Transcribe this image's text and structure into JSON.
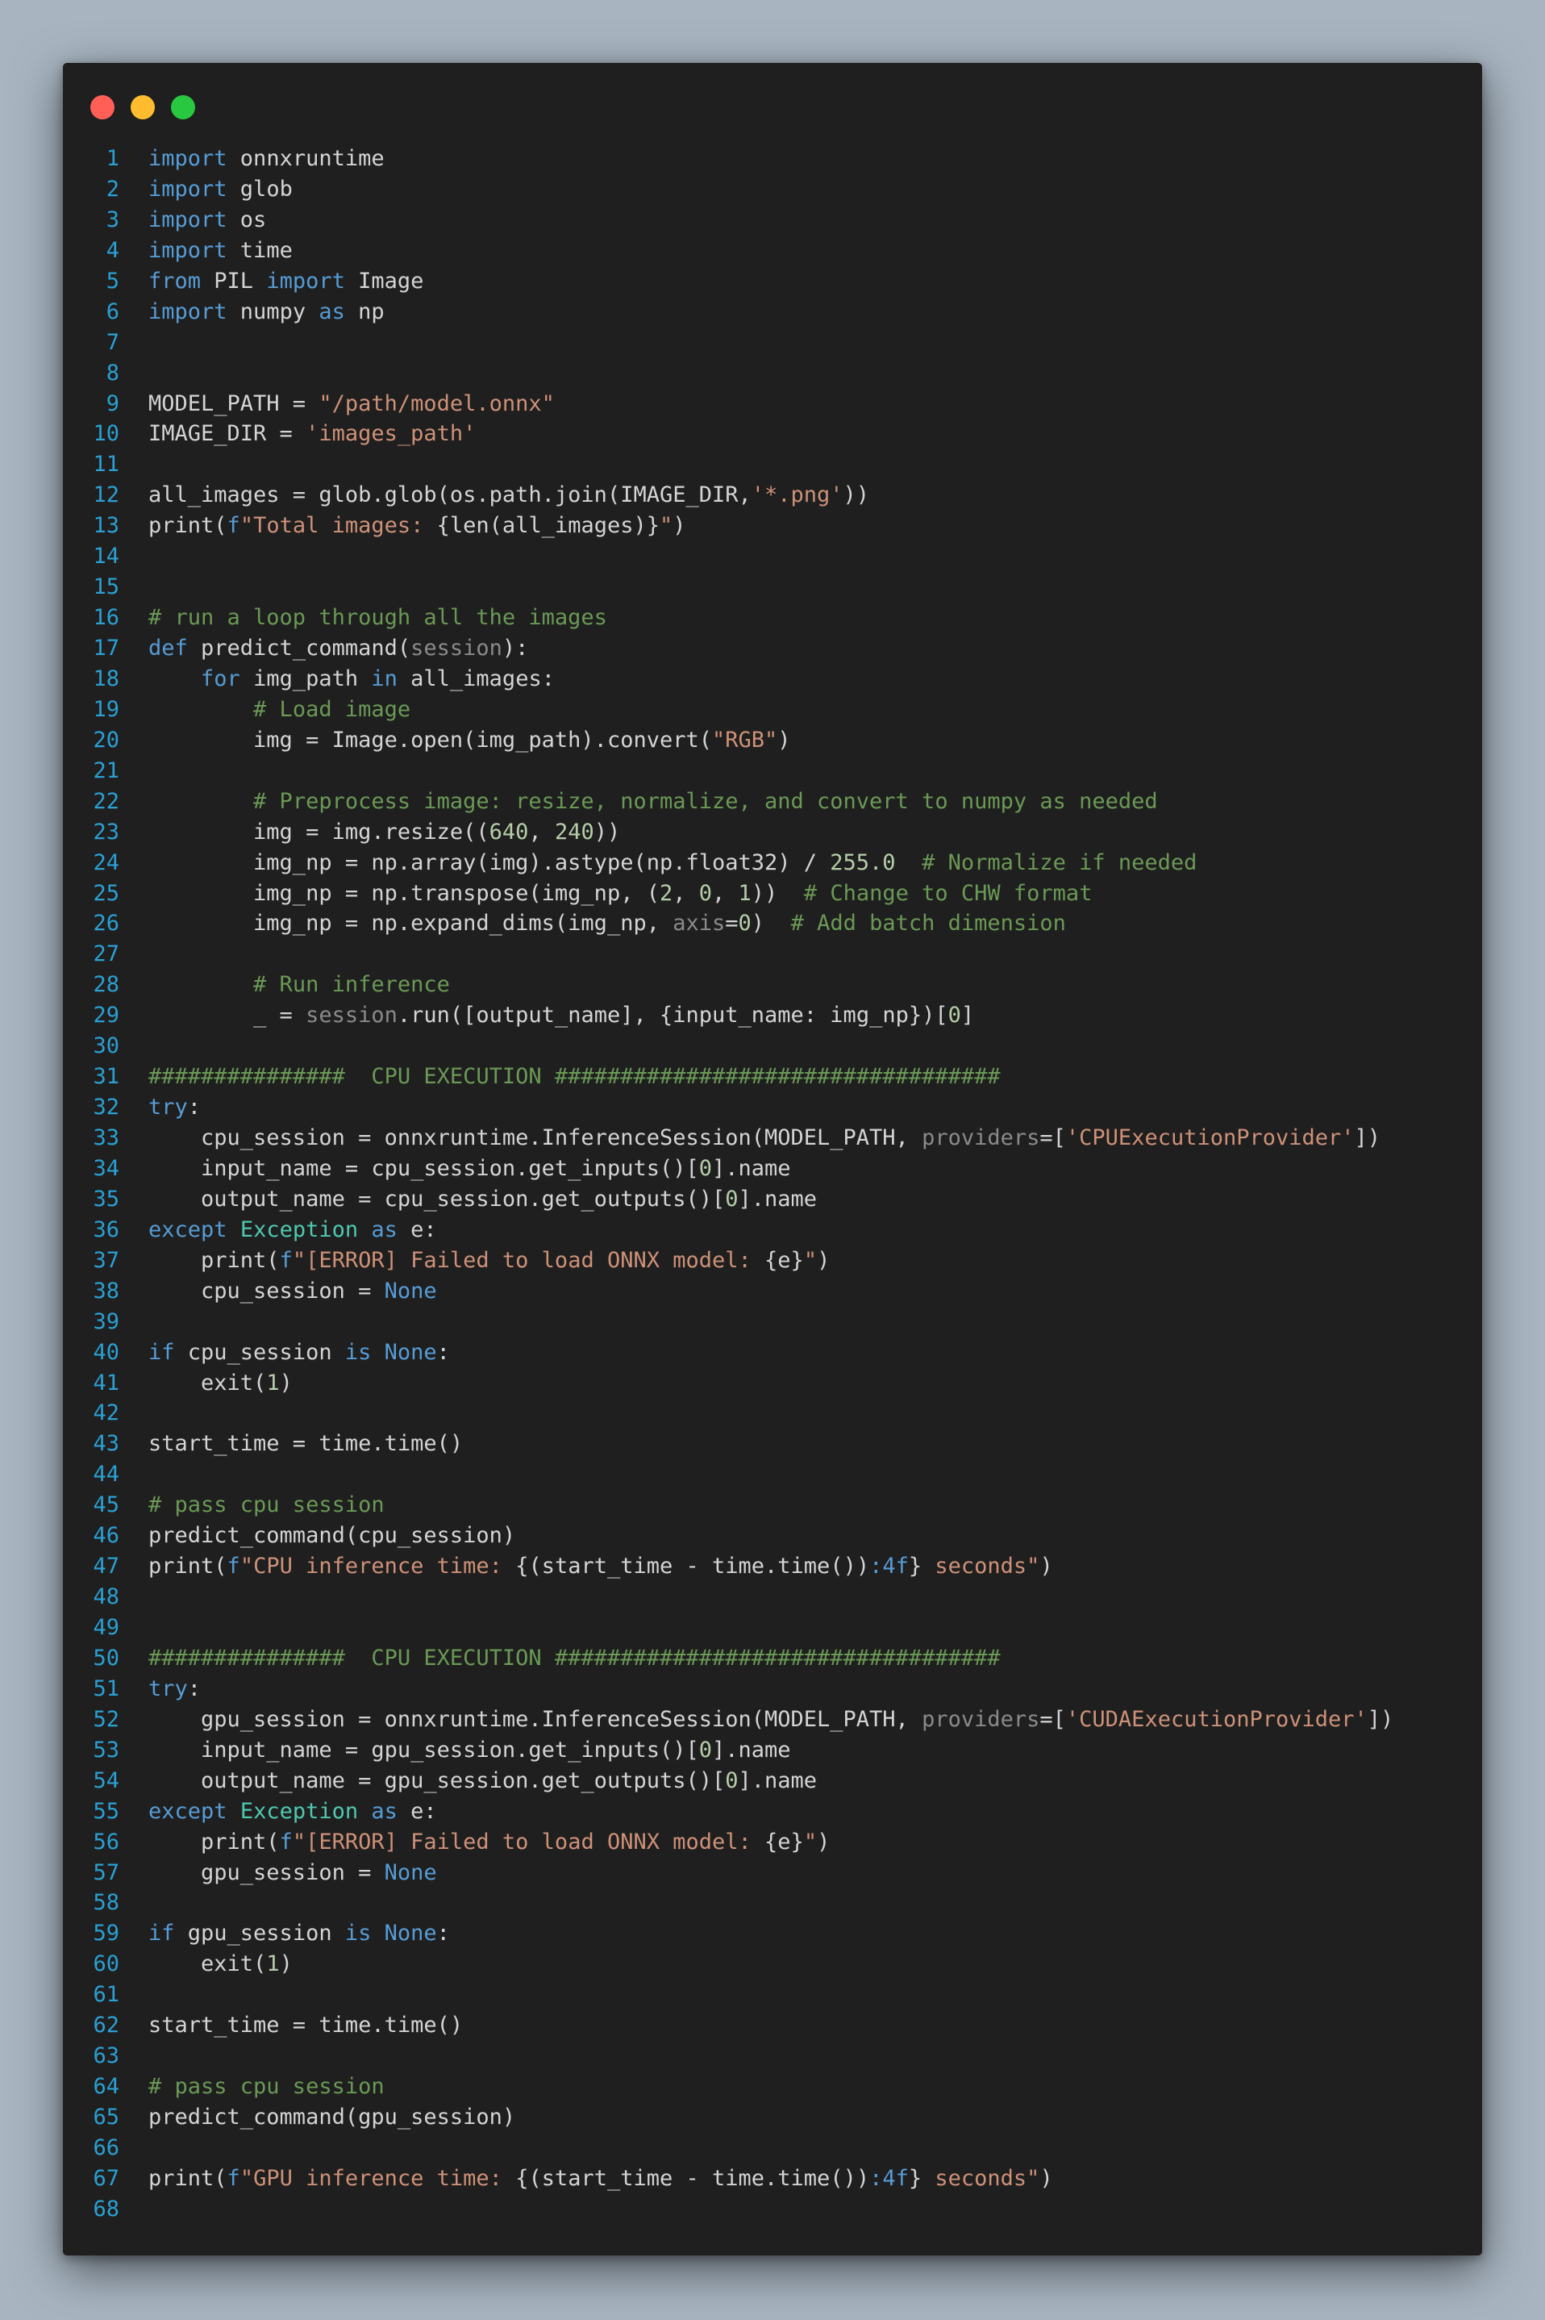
{
  "window": {
    "controls": [
      "close",
      "minimize",
      "zoom"
    ],
    "colors": {
      "close": "#ff5f57",
      "minimize": "#febc2e",
      "zoom": "#28c840"
    }
  },
  "editor": {
    "language": "python",
    "lines": [
      {
        "n": "1",
        "t": [
          [
            "kw",
            "import"
          ],
          [
            "pl",
            " onnxruntime"
          ]
        ]
      },
      {
        "n": "2",
        "t": [
          [
            "kw",
            "import"
          ],
          [
            "pl",
            " glob"
          ]
        ]
      },
      {
        "n": "3",
        "t": [
          [
            "kw",
            "import"
          ],
          [
            "pl",
            " os"
          ]
        ]
      },
      {
        "n": "4",
        "t": [
          [
            "kw",
            "import"
          ],
          [
            "pl",
            " time"
          ]
        ]
      },
      {
        "n": "5",
        "t": [
          [
            "kw",
            "from"
          ],
          [
            "pl",
            " PIL "
          ],
          [
            "kw",
            "import"
          ],
          [
            "pl",
            " Image"
          ]
        ]
      },
      {
        "n": "6",
        "t": [
          [
            "kw",
            "import"
          ],
          [
            "pl",
            " numpy "
          ],
          [
            "kw",
            "as"
          ],
          [
            "pl",
            " np"
          ]
        ]
      },
      {
        "n": "7",
        "t": []
      },
      {
        "n": "8",
        "t": []
      },
      {
        "n": "9",
        "t": [
          [
            "pl",
            "MODEL_PATH = "
          ],
          [
            "str",
            "\"/path/model.onnx\""
          ]
        ]
      },
      {
        "n": "10",
        "t": [
          [
            "pl",
            "IMAGE_DIR = "
          ],
          [
            "str",
            "'images_path'"
          ]
        ]
      },
      {
        "n": "11",
        "t": []
      },
      {
        "n": "12",
        "t": [
          [
            "pl",
            "all_images = glob.glob(os.path.join(IMAGE_DIR,"
          ],
          [
            "str",
            "'*.png'"
          ],
          [
            "pl",
            "))"
          ]
        ]
      },
      {
        "n": "13",
        "t": [
          [
            "pl",
            "print("
          ],
          [
            "kw",
            "f"
          ],
          [
            "str",
            "\"Total images: "
          ],
          [
            "pl",
            "{len(all_images)}"
          ],
          [
            "str",
            "\""
          ],
          [
            "pl",
            ")"
          ]
        ]
      },
      {
        "n": "14",
        "t": []
      },
      {
        "n": "15",
        "t": []
      },
      {
        "n": "16",
        "t": [
          [
            "cm",
            "# run a loop through all the images"
          ]
        ]
      },
      {
        "n": "17",
        "t": [
          [
            "kw",
            "def"
          ],
          [
            "pl",
            " predict_command("
          ],
          [
            "prm",
            "session"
          ],
          [
            "pl",
            "):"
          ]
        ]
      },
      {
        "n": "18",
        "t": [
          [
            "pl",
            "    "
          ],
          [
            "kw",
            "for"
          ],
          [
            "pl",
            " img_path "
          ],
          [
            "kw",
            "in"
          ],
          [
            "pl",
            " all_images:"
          ]
        ]
      },
      {
        "n": "19",
        "t": [
          [
            "pl",
            "        "
          ],
          [
            "cm",
            "# Load image"
          ]
        ]
      },
      {
        "n": "20",
        "t": [
          [
            "pl",
            "        img = Image.open(img_path).convert("
          ],
          [
            "str",
            "\"RGB\""
          ],
          [
            "pl",
            ")"
          ]
        ]
      },
      {
        "n": "21",
        "t": []
      },
      {
        "n": "22",
        "t": [
          [
            "pl",
            "        "
          ],
          [
            "cm",
            "# Preprocess image: resize, normalize, and convert to numpy as needed"
          ]
        ]
      },
      {
        "n": "23",
        "t": [
          [
            "pl",
            "        img = img.resize(("
          ],
          [
            "num",
            "640"
          ],
          [
            "pl",
            ", "
          ],
          [
            "num",
            "240"
          ],
          [
            "pl",
            "))"
          ]
        ]
      },
      {
        "n": "24",
        "t": [
          [
            "pl",
            "        img_np = np.array(img).astype(np.float32) / "
          ],
          [
            "num",
            "255.0"
          ],
          [
            "pl",
            "  "
          ],
          [
            "cm",
            "# Normalize if needed"
          ]
        ]
      },
      {
        "n": "25",
        "t": [
          [
            "pl",
            "        img_np = np.transpose(img_np, ("
          ],
          [
            "num",
            "2"
          ],
          [
            "pl",
            ", "
          ],
          [
            "num",
            "0"
          ],
          [
            "pl",
            ", "
          ],
          [
            "num",
            "1"
          ],
          [
            "pl",
            "))  "
          ],
          [
            "cm",
            "# Change to CHW format"
          ]
        ]
      },
      {
        "n": "26",
        "t": [
          [
            "pl",
            "        img_np = np.expand_dims(img_np, "
          ],
          [
            "prm",
            "axis"
          ],
          [
            "pl",
            "="
          ],
          [
            "num",
            "0"
          ],
          [
            "pl",
            ")  "
          ],
          [
            "cm",
            "# Add batch dimension"
          ]
        ]
      },
      {
        "n": "27",
        "t": []
      },
      {
        "n": "28",
        "t": [
          [
            "pl",
            "        "
          ],
          [
            "cm",
            "# Run inference"
          ]
        ]
      },
      {
        "n": "29",
        "t": [
          [
            "pl",
            "        _ = "
          ],
          [
            "prm",
            "session"
          ],
          [
            "pl",
            ".run([output_name], {input_name: img_np})["
          ],
          [
            "num",
            "0"
          ],
          [
            "pl",
            "]"
          ]
        ]
      },
      {
        "n": "30",
        "t": []
      },
      {
        "n": "31",
        "t": [
          [
            "cm",
            "###############  CPU EXECUTION ##################################"
          ]
        ]
      },
      {
        "n": "32",
        "t": [
          [
            "kw",
            "try"
          ],
          [
            "pl",
            ":"
          ]
        ]
      },
      {
        "n": "33",
        "t": [
          [
            "pl",
            "    cpu_session = onnxruntime.InferenceSession(MODEL_PATH, "
          ],
          [
            "prm",
            "providers"
          ],
          [
            "pl",
            "=["
          ],
          [
            "str",
            "'CPUExecutionProvider'"
          ],
          [
            "pl",
            "])"
          ]
        ]
      },
      {
        "n": "34",
        "t": [
          [
            "pl",
            "    input_name = cpu_session.get_inputs()["
          ],
          [
            "num",
            "0"
          ],
          [
            "pl",
            "].name"
          ]
        ]
      },
      {
        "n": "35",
        "t": [
          [
            "pl",
            "    output_name = cpu_session.get_outputs()["
          ],
          [
            "num",
            "0"
          ],
          [
            "pl",
            "].name"
          ]
        ]
      },
      {
        "n": "36",
        "t": [
          [
            "kw",
            "except"
          ],
          [
            "pl",
            " "
          ],
          [
            "cls",
            "Exception"
          ],
          [
            "pl",
            " "
          ],
          [
            "kw",
            "as"
          ],
          [
            "pl",
            " e:"
          ]
        ]
      },
      {
        "n": "37",
        "t": [
          [
            "pl",
            "    print("
          ],
          [
            "kw",
            "f"
          ],
          [
            "str",
            "\"[ERROR] Failed to load ONNX model: "
          ],
          [
            "pl",
            "{e}"
          ],
          [
            "str",
            "\""
          ],
          [
            "pl",
            ")"
          ]
        ]
      },
      {
        "n": "38",
        "t": [
          [
            "pl",
            "    cpu_session = "
          ],
          [
            "kw",
            "None"
          ]
        ]
      },
      {
        "n": "39",
        "t": []
      },
      {
        "n": "40",
        "t": [
          [
            "kw",
            "if"
          ],
          [
            "pl",
            " cpu_session "
          ],
          [
            "kw",
            "is"
          ],
          [
            "pl",
            " "
          ],
          [
            "kw",
            "None"
          ],
          [
            "pl",
            ":"
          ]
        ]
      },
      {
        "n": "41",
        "t": [
          [
            "pl",
            "    exit("
          ],
          [
            "num",
            "1"
          ],
          [
            "pl",
            ")"
          ]
        ]
      },
      {
        "n": "42",
        "t": []
      },
      {
        "n": "43",
        "t": [
          [
            "pl",
            "start_time = time.time()"
          ]
        ]
      },
      {
        "n": "44",
        "t": []
      },
      {
        "n": "45",
        "t": [
          [
            "cm",
            "# pass cpu session"
          ]
        ]
      },
      {
        "n": "46",
        "t": [
          [
            "pl",
            "predict_command(cpu_session)"
          ]
        ]
      },
      {
        "n": "47",
        "t": [
          [
            "pl",
            "print("
          ],
          [
            "kw",
            "f"
          ],
          [
            "str",
            "\"CPU inference time: "
          ],
          [
            "pl",
            "{(start_time - time.time())"
          ],
          [
            "kw",
            ":4f"
          ],
          [
            "pl",
            "}"
          ],
          [
            "str",
            " seconds\""
          ],
          [
            "pl",
            ")"
          ]
        ]
      },
      {
        "n": "48",
        "t": []
      },
      {
        "n": "49",
        "t": []
      },
      {
        "n": "50",
        "t": [
          [
            "cm",
            "###############  CPU EXECUTION ##################################"
          ]
        ]
      },
      {
        "n": "51",
        "t": [
          [
            "kw",
            "try"
          ],
          [
            "pl",
            ":"
          ]
        ]
      },
      {
        "n": "52",
        "t": [
          [
            "pl",
            "    gpu_session = onnxruntime.InferenceSession(MODEL_PATH, "
          ],
          [
            "prm",
            "providers"
          ],
          [
            "pl",
            "=["
          ],
          [
            "str",
            "'CUDAExecutionProvider'"
          ],
          [
            "pl",
            "])"
          ]
        ]
      },
      {
        "n": "53",
        "t": [
          [
            "pl",
            "    input_name = gpu_session.get_inputs()["
          ],
          [
            "num",
            "0"
          ],
          [
            "pl",
            "].name"
          ]
        ]
      },
      {
        "n": "54",
        "t": [
          [
            "pl",
            "    output_name = gpu_session.get_outputs()["
          ],
          [
            "num",
            "0"
          ],
          [
            "pl",
            "].name"
          ]
        ]
      },
      {
        "n": "55",
        "t": [
          [
            "kw",
            "except"
          ],
          [
            "pl",
            " "
          ],
          [
            "cls",
            "Exception"
          ],
          [
            "pl",
            " "
          ],
          [
            "kw",
            "as"
          ],
          [
            "pl",
            " e:"
          ]
        ]
      },
      {
        "n": "56",
        "t": [
          [
            "pl",
            "    print("
          ],
          [
            "kw",
            "f"
          ],
          [
            "str",
            "\"[ERROR] Failed to load ONNX model: "
          ],
          [
            "pl",
            "{e}"
          ],
          [
            "str",
            "\""
          ],
          [
            "pl",
            ")"
          ]
        ]
      },
      {
        "n": "57",
        "t": [
          [
            "pl",
            "    gpu_session = "
          ],
          [
            "kw",
            "None"
          ]
        ]
      },
      {
        "n": "58",
        "t": []
      },
      {
        "n": "59",
        "t": [
          [
            "kw",
            "if"
          ],
          [
            "pl",
            " gpu_session "
          ],
          [
            "kw",
            "is"
          ],
          [
            "pl",
            " "
          ],
          [
            "kw",
            "None"
          ],
          [
            "pl",
            ":"
          ]
        ]
      },
      {
        "n": "60",
        "t": [
          [
            "pl",
            "    exit("
          ],
          [
            "num",
            "1"
          ],
          [
            "pl",
            ")"
          ]
        ]
      },
      {
        "n": "61",
        "t": []
      },
      {
        "n": "62",
        "t": [
          [
            "pl",
            "start_time = time.time()"
          ]
        ]
      },
      {
        "n": "63",
        "t": []
      },
      {
        "n": "64",
        "t": [
          [
            "cm",
            "# pass cpu session"
          ]
        ]
      },
      {
        "n": "65",
        "t": [
          [
            "pl",
            "predict_command(gpu_session)"
          ]
        ]
      },
      {
        "n": "66",
        "t": []
      },
      {
        "n": "67",
        "t": [
          [
            "pl",
            "print("
          ],
          [
            "kw",
            "f"
          ],
          [
            "str",
            "\"GPU inference time: "
          ],
          [
            "pl",
            "{(start_time - time.time())"
          ],
          [
            "kw",
            ":4f"
          ],
          [
            "pl",
            "}"
          ],
          [
            "str",
            " seconds\""
          ],
          [
            "pl",
            ")"
          ]
        ]
      },
      {
        "n": "68",
        "t": []
      }
    ]
  },
  "colors": {
    "background": "#a8b5c1",
    "editor_bg": "#1f1f1f",
    "line_number": "#2aa0d3",
    "keyword": "#569cd6",
    "string": "#ce9178",
    "comment": "#6a9955",
    "number": "#b5cea8",
    "class": "#4ec9b0",
    "param": "#8a8a8a",
    "plain": "#d4d4d4"
  }
}
